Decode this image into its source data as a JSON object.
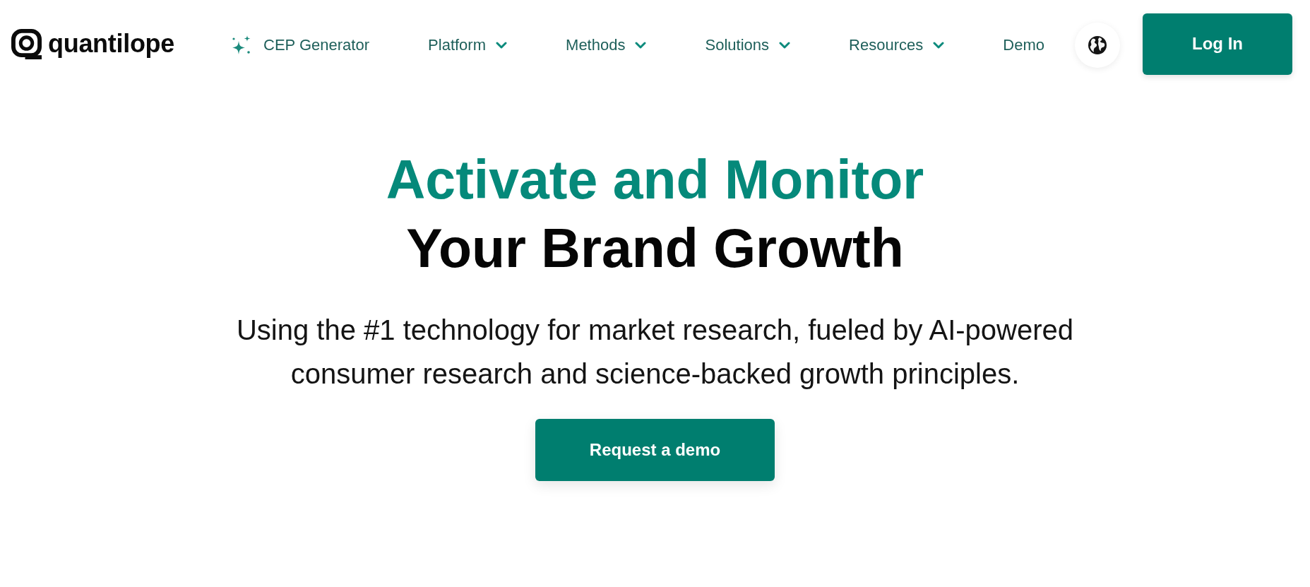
{
  "header": {
    "logo": {
      "text": "quantilope"
    },
    "nav": [
      {
        "label": "CEP Generator",
        "kind": "sparkle"
      },
      {
        "label": "Platform",
        "kind": "dropdown"
      },
      {
        "label": "Methods",
        "kind": "dropdown"
      },
      {
        "label": "Solutions",
        "kind": "dropdown"
      },
      {
        "label": "Resources",
        "kind": "dropdown"
      },
      {
        "label": "Demo",
        "kind": "plain"
      }
    ],
    "login_button": "Log In"
  },
  "hero": {
    "title_line_1": "Activate and Monitor",
    "title_line_2": "Your Brand Growth",
    "subtitle": "Using the #1 technology for market research, fueled by AI-powered consumer research and science-backed growth principles.",
    "cta_button": "Request a demo"
  }
}
